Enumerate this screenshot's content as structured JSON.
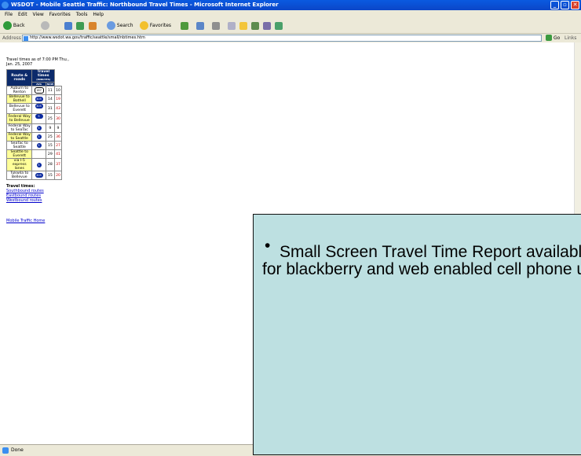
{
  "window": {
    "title": "WSDOT - Mobile Seattle Traffic: Northbound Travel Times - Microsoft Internet Explorer",
    "minimize": "_",
    "maximize": "▫",
    "close": "✕"
  },
  "menu": [
    "File",
    "Edit",
    "View",
    "Favorites",
    "Tools",
    "Help"
  ],
  "toolbar": {
    "back": "Back",
    "search": "Search",
    "favorites": "Favorites"
  },
  "address": {
    "label": "Address",
    "url": "http://www.wsdot.wa.gov/traffic/seattle/small/nbtimes.htm",
    "go": "Go",
    "links": "Links"
  },
  "page": {
    "as_of": "Travel times as of 7:00 PM Thu., Jan. 25, 2007",
    "header_route": "Route & roads",
    "header_times": "Travel times",
    "header_minutes": "(MINUTES)",
    "header_avg": "AVG",
    "header_now": "NOW",
    "rows": [
      {
        "route": "Auburn to Renton",
        "shield": "167",
        "avg": "11",
        "now": "10",
        "highlight": false
      },
      {
        "route": "Bellevue to Bothell",
        "shield": "405",
        "avg": "14",
        "now": "19",
        "highlight": true
      },
      {
        "route": "Bellevue to Everett",
        "shield": "405 5",
        "avg": "31",
        "now": "43",
        "highlight": false
      },
      {
        "route": "Federal Way to Bellevue",
        "shield": "5 405",
        "avg": "25",
        "now": "30",
        "highlight": true
      },
      {
        "route": "Federal Way to SeaTac",
        "shield": "5",
        "avg": "9",
        "now": "9",
        "highlight": false
      },
      {
        "route": "Federal Way to Seattle",
        "shield": "5",
        "avg": "25",
        "now": "36",
        "highlight": true
      },
      {
        "route": "SeaTac to Seattle",
        "shield": "5",
        "avg": "15",
        "now": "27",
        "highlight": false
      },
      {
        "route": "Seattle to Everett",
        "shield": "",
        "avg": "29",
        "now": "41",
        "highlight": true
      },
      {
        "route": "via I-5 express lanes",
        "shield": "5",
        "avg": "28",
        "now": "37",
        "highlight": true
      },
      {
        "route": "Tukwila to Bellevue",
        "shield": "405",
        "avg": "15",
        "now": "20",
        "highlight": false
      }
    ],
    "section_title": "Travel times:",
    "links": [
      "Southbound routes",
      "Eastbound routes",
      "Westbound routes"
    ],
    "home_link": "Mobile Traffic Home"
  },
  "status": {
    "text": "Done"
  },
  "callout": {
    "bullet": "•",
    "text": "Small Screen Travel Time Report available for blackberry and web enabled cell phone use"
  },
  "colors": {
    "title_bar": "#0b46c8",
    "chrome": "#ece9d8",
    "callout_bg": "#bde0e1",
    "table_header": "#0b2a6b",
    "highlight": "#ffff99"
  }
}
